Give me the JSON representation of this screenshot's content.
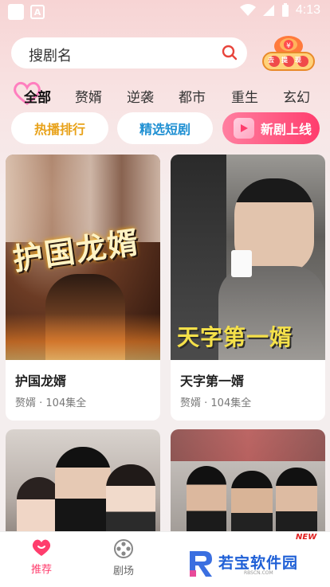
{
  "status_bar": {
    "time": "4:13"
  },
  "search": {
    "placeholder": "搜剧名"
  },
  "reward": {
    "label": "去提现"
  },
  "categories": [
    {
      "label": "全部",
      "active": true
    },
    {
      "label": "赘婿",
      "active": false
    },
    {
      "label": "逆袭",
      "active": false
    },
    {
      "label": "都市",
      "active": false
    },
    {
      "label": "重生",
      "active": false
    },
    {
      "label": "玄幻",
      "active": false
    }
  ],
  "pills": {
    "hot": "热播排行",
    "pick": "精选短剧",
    "new": "新剧上线"
  },
  "cards": [
    {
      "poster_title": "护国龙婿",
      "title": "护国龙婿",
      "meta": "赘婿 · 104集全"
    },
    {
      "poster_title": "天字第一婿",
      "title": "天字第一婿",
      "meta": "赘婿 · 104集全"
    },
    {
      "poster_title": "",
      "title": "",
      "meta": ""
    },
    {
      "poster_title": "",
      "title": "",
      "meta": ""
    }
  ],
  "nav": [
    {
      "label": "推荐",
      "icon": "heart-chat-icon",
      "active": true
    },
    {
      "label": "剧场",
      "icon": "film-reel-icon",
      "active": false
    }
  ],
  "nav_new_tag": "NEW",
  "watermark": {
    "text": "若宝软件园",
    "sub": "RBSCN.COM"
  },
  "colors": {
    "accent": "#ff3d6d",
    "hot": "#e8a21a",
    "pick": "#1e8fd2"
  }
}
